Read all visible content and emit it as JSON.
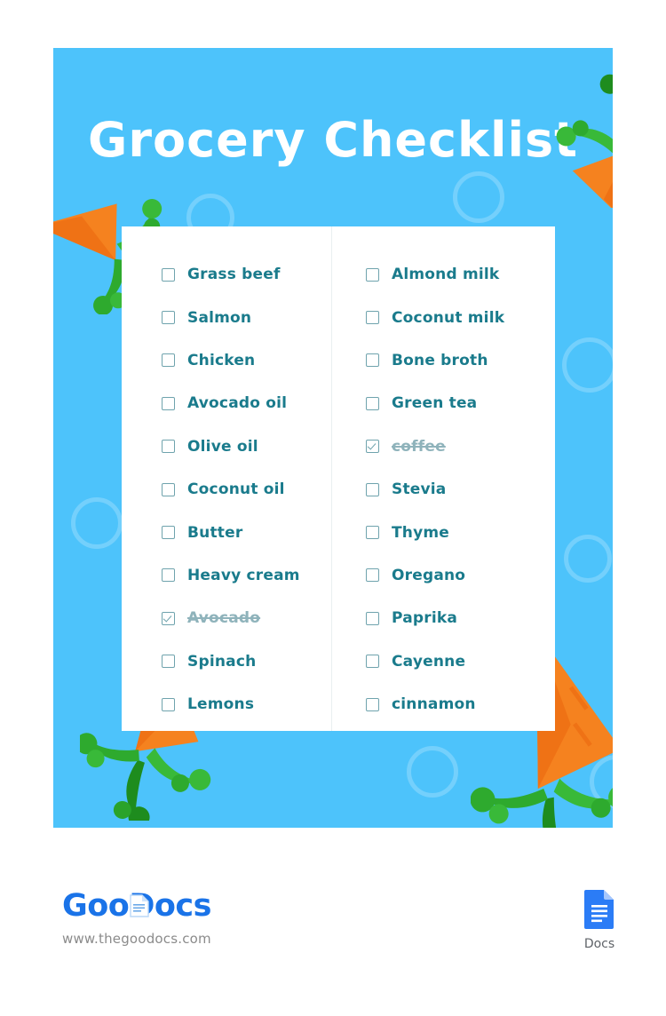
{
  "document": {
    "title": "Grocery Checklist"
  },
  "checklist": {
    "left_column": [
      {
        "label": "Grass beef",
        "checked": false
      },
      {
        "label": "Salmon",
        "checked": false
      },
      {
        "label": "Chicken",
        "checked": false
      },
      {
        "label": "Avocado oil",
        "checked": false
      },
      {
        "label": "Olive oil",
        "checked": false
      },
      {
        "label": "Coconut oil",
        "checked": false
      },
      {
        "label": "Butter",
        "checked": false
      },
      {
        "label": "Heavy cream",
        "checked": false
      },
      {
        "label": "Avocado",
        "checked": true
      },
      {
        "label": "Spinach",
        "checked": false
      },
      {
        "label": "Lemons",
        "checked": false
      }
    ],
    "right_column": [
      {
        "label": "Almond milk",
        "checked": false
      },
      {
        "label": "Coconut milk",
        "checked": false
      },
      {
        "label": "Bone broth",
        "checked": false
      },
      {
        "label": "Green tea",
        "checked": false
      },
      {
        "label": "coffee",
        "checked": true
      },
      {
        "label": "Stevia",
        "checked": false
      },
      {
        "label": "Thyme",
        "checked": false
      },
      {
        "label": "Oregano",
        "checked": false
      },
      {
        "label": "Paprika",
        "checked": false
      },
      {
        "label": "Cayenne",
        "checked": false
      },
      {
        "label": "cinnamon",
        "checked": false
      }
    ]
  },
  "footer": {
    "brand_part1": "Goo",
    "brand_part2": "Docs",
    "url": "www.thegoodocs.com",
    "docs_label": "Docs"
  },
  "decorations": {
    "carrots": [
      {
        "name": "carrot-top-right"
      },
      {
        "name": "carrot-left"
      },
      {
        "name": "carrot-bottom-left"
      },
      {
        "name": "carrot-bottom-right"
      }
    ],
    "circles": [
      {
        "name": "circle-1"
      },
      {
        "name": "circle-2"
      },
      {
        "name": "circle-3"
      },
      {
        "name": "circle-4"
      },
      {
        "name": "circle-5"
      },
      {
        "name": "circle-6"
      },
      {
        "name": "circle-7"
      }
    ]
  },
  "colors": {
    "panel_blue": "#4dc3fb",
    "text_teal": "#1a7b8c",
    "done_grey": "#8fb3bb",
    "carrot_orange": "#f5821f",
    "leaf_green": "#34a724",
    "brand_blue": "#1a73e8"
  }
}
